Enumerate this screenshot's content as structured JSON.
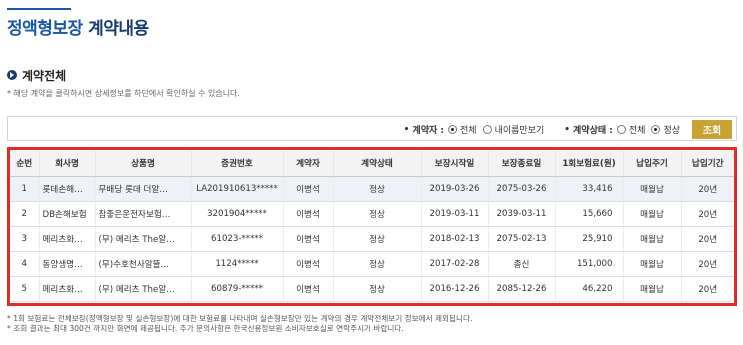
{
  "page": {
    "title_part1": "정액형보장",
    "title_part2": "계약내용"
  },
  "section": {
    "title": "계약전체",
    "description": "* 해당 계약을 클릭하시면 상세정보를 하단에서 확인하실 수 있습니다."
  },
  "filter": {
    "contractor_label": "계약자 :",
    "contractor_options": [
      {
        "label": "전체",
        "selected": true
      },
      {
        "label": "내이름만보기",
        "selected": false
      }
    ],
    "status_label": "계약상태 :",
    "status_options": [
      {
        "label": "전체",
        "selected": false
      },
      {
        "label": "정상",
        "selected": true
      }
    ],
    "search_label": "조회",
    "search_color": "#c9a234"
  },
  "table": {
    "highlight_color": "#e02b2b",
    "headers": [
      "순번",
      "회사명",
      "상품명",
      "증권번호",
      "계약자",
      "계약상태",
      "보장시작일",
      "보장종료일",
      "1회보험료(원)",
      "납입주기",
      "납입기간"
    ],
    "rows": [
      [
        "1",
        "롯데손해…",
        "무배당 롯데 더알…",
        "LA201910613*****",
        "이병석",
        "정상",
        "2019-03-26",
        "2075-03-26",
        "33,416",
        "매월납",
        "20년"
      ],
      [
        "2",
        "DB손해보험",
        "참좋은운전자보험…",
        "3201904*****",
        "이병석",
        "정상",
        "2019-03-11",
        "2039-03-11",
        "15,660",
        "매월납",
        "20년"
      ],
      [
        "3",
        "메리츠화…",
        "(무) 메리츠 The알…",
        "61023-*****",
        "이병석",
        "정상",
        "2018-02-13",
        "2075-02-13",
        "25,910",
        "매월납",
        "20년"
      ],
      [
        "4",
        "동양생명…",
        "(무)수호천사알뜰…",
        "1124*****",
        "이병석",
        "정상",
        "2017-02-28",
        "종신",
        "151,000",
        "매월납",
        "20년"
      ],
      [
        "5",
        "메리츠화…",
        "(무) 메리츠 The알…",
        "60879-*****",
        "이병석",
        "정상",
        "2016-12-26",
        "2085-12-26",
        "46,220",
        "매월납",
        "20년"
      ]
    ]
  },
  "footnotes": [
    "* 1회 보험료는 전체보장(정액형보장 및 실손형보장)에 대한 보험료를 나타내며 실손형보장만 있는 계약의 경우 계약전체보기 정보에서 제외됩니다.",
    "* 조회 결과는 최대 300건 까지만 화면에 제공됩니다. 추가 문의사항은 한국신용정보원 소비자보호실로 연락주시기 바랍니다."
  ]
}
